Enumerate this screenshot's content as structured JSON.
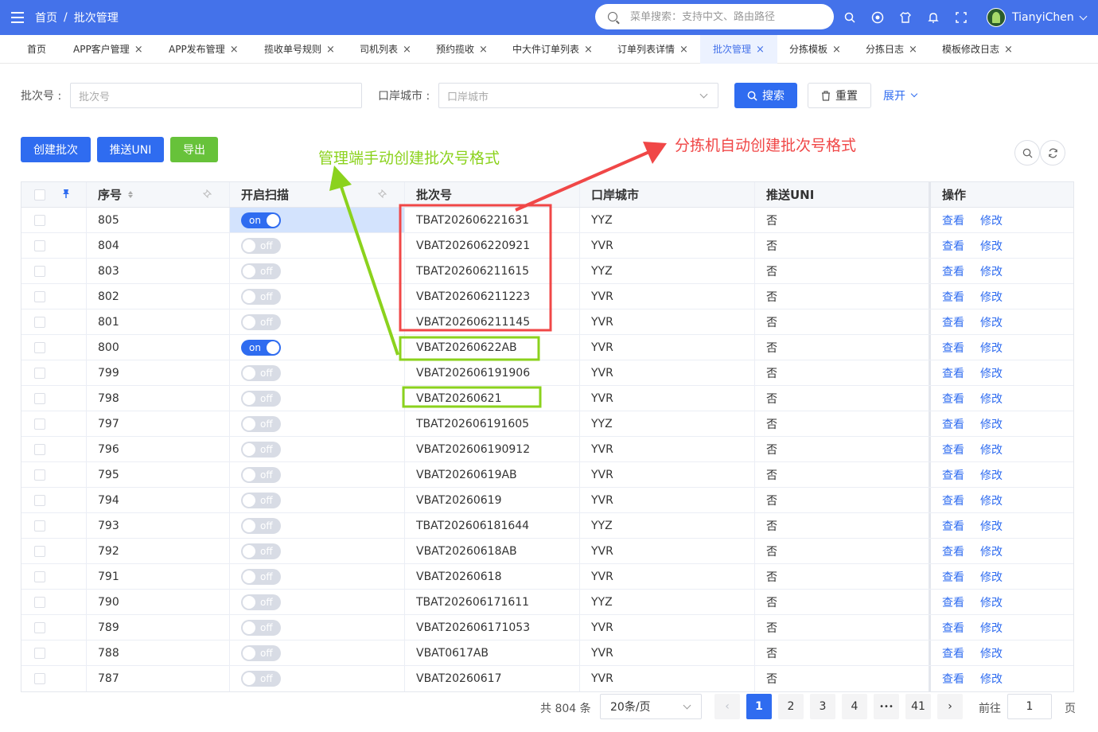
{
  "header": {
    "breadcrumb": [
      "首页",
      "批次管理"
    ],
    "breadcrumb_sep": "/",
    "search_placeholder": "菜单搜索：支持中文、路由路径",
    "user_name": "TianyiChen",
    "icons": [
      "search-icon",
      "github-icon",
      "theme-icon",
      "bell-icon",
      "fullscreen-icon"
    ]
  },
  "tabs": [
    {
      "label": "首页",
      "closable": false
    },
    {
      "label": "APP客户管理",
      "closable": true
    },
    {
      "label": "APP发布管理",
      "closable": true
    },
    {
      "label": "揽收单号规则",
      "closable": true
    },
    {
      "label": "司机列表",
      "closable": true
    },
    {
      "label": "预约揽收",
      "closable": true
    },
    {
      "label": "中大件订单列表",
      "closable": true
    },
    {
      "label": "订单列表详情",
      "closable": true
    },
    {
      "label": "批次管理",
      "closable": true,
      "active": true
    },
    {
      "label": "分拣模板",
      "closable": true
    },
    {
      "label": "分拣日志",
      "closable": true
    },
    {
      "label": "模板修改日志",
      "closable": true
    }
  ],
  "close_glyph": "×",
  "search_form": {
    "batch_label": "批次号 :",
    "batch_placeholder": "批次号",
    "city_label": "口岸城市 :",
    "city_placeholder": "口岸城市",
    "search_button": "搜索",
    "reset_button": "重置",
    "expand_label": "展开"
  },
  "toolbar": {
    "create_button": "创建批次",
    "push_button": "推送UNI",
    "export_button": "导出"
  },
  "table": {
    "columns": [
      "序号",
      "开启扫描",
      "批次号",
      "口岸城市",
      "推送UNI",
      "操作"
    ],
    "view_label": "查看",
    "edit_label": "修改",
    "rows": [
      {
        "seq": "805",
        "scan": "on",
        "batch": "TBAT202606221631",
        "city": "YYZ",
        "uni": "否"
      },
      {
        "seq": "804",
        "scan": "off",
        "batch": "VBAT202606220921",
        "city": "YVR",
        "uni": "否"
      },
      {
        "seq": "803",
        "scan": "off",
        "batch": "TBAT202606211615",
        "city": "YYZ",
        "uni": "否"
      },
      {
        "seq": "802",
        "scan": "off",
        "batch": "VBAT202606211223",
        "city": "YVR",
        "uni": "否"
      },
      {
        "seq": "801",
        "scan": "off",
        "batch": "VBAT202606211145",
        "city": "YVR",
        "uni": "否"
      },
      {
        "seq": "800",
        "scan": "on",
        "batch": "VBAT20260622AB",
        "city": "YVR",
        "uni": "否"
      },
      {
        "seq": "799",
        "scan": "off",
        "batch": "VBAT202606191906",
        "city": "YVR",
        "uni": "否"
      },
      {
        "seq": "798",
        "scan": "off",
        "batch": "VBAT20260621",
        "city": "YVR",
        "uni": "否"
      },
      {
        "seq": "797",
        "scan": "off",
        "batch": "TBAT202606191605",
        "city": "YYZ",
        "uni": "否"
      },
      {
        "seq": "796",
        "scan": "off",
        "batch": "VBAT202606190912",
        "city": "YVR",
        "uni": "否"
      },
      {
        "seq": "795",
        "scan": "off",
        "batch": "VBAT20260619AB",
        "city": "YVR",
        "uni": "否"
      },
      {
        "seq": "794",
        "scan": "off",
        "batch": "VBAT20260619",
        "city": "YVR",
        "uni": "否"
      },
      {
        "seq": "793",
        "scan": "off",
        "batch": "TBAT202606181644",
        "city": "YYZ",
        "uni": "否"
      },
      {
        "seq": "792",
        "scan": "off",
        "batch": "VBAT20260618AB",
        "city": "YVR",
        "uni": "否"
      },
      {
        "seq": "791",
        "scan": "off",
        "batch": "VBAT20260618",
        "city": "YVR",
        "uni": "否"
      },
      {
        "seq": "790",
        "scan": "off",
        "batch": "TBAT202606171611",
        "city": "YYZ",
        "uni": "否"
      },
      {
        "seq": "789",
        "scan": "off",
        "batch": "VBAT202606171053",
        "city": "YVR",
        "uni": "否"
      },
      {
        "seq": "788",
        "scan": "off",
        "batch": "VBAT0617AB",
        "city": "YVR",
        "uni": "否"
      },
      {
        "seq": "787",
        "scan": "off",
        "batch": "VBAT20260617",
        "city": "YVR",
        "uni": "否"
      }
    ]
  },
  "pagination": {
    "total_text": "共 804 条",
    "page_size": "20条/页",
    "pages": [
      "1",
      "2",
      "3",
      "4",
      "•••",
      "41"
    ],
    "current_page": "1",
    "goto_label": "前往",
    "goto_value": "1",
    "page_suffix": "页",
    "prev_glyph": "‹",
    "next_glyph": "›"
  },
  "annotations": {
    "manual_label": "管理端手动创建批次号格式",
    "auto_label": "分拣机自动创建批次号格式",
    "green": "#8bd21d",
    "red": "#f04747"
  },
  "colors": {
    "primary": "#2f6cf0",
    "header": "#4472ea",
    "success": "#67c23a"
  }
}
